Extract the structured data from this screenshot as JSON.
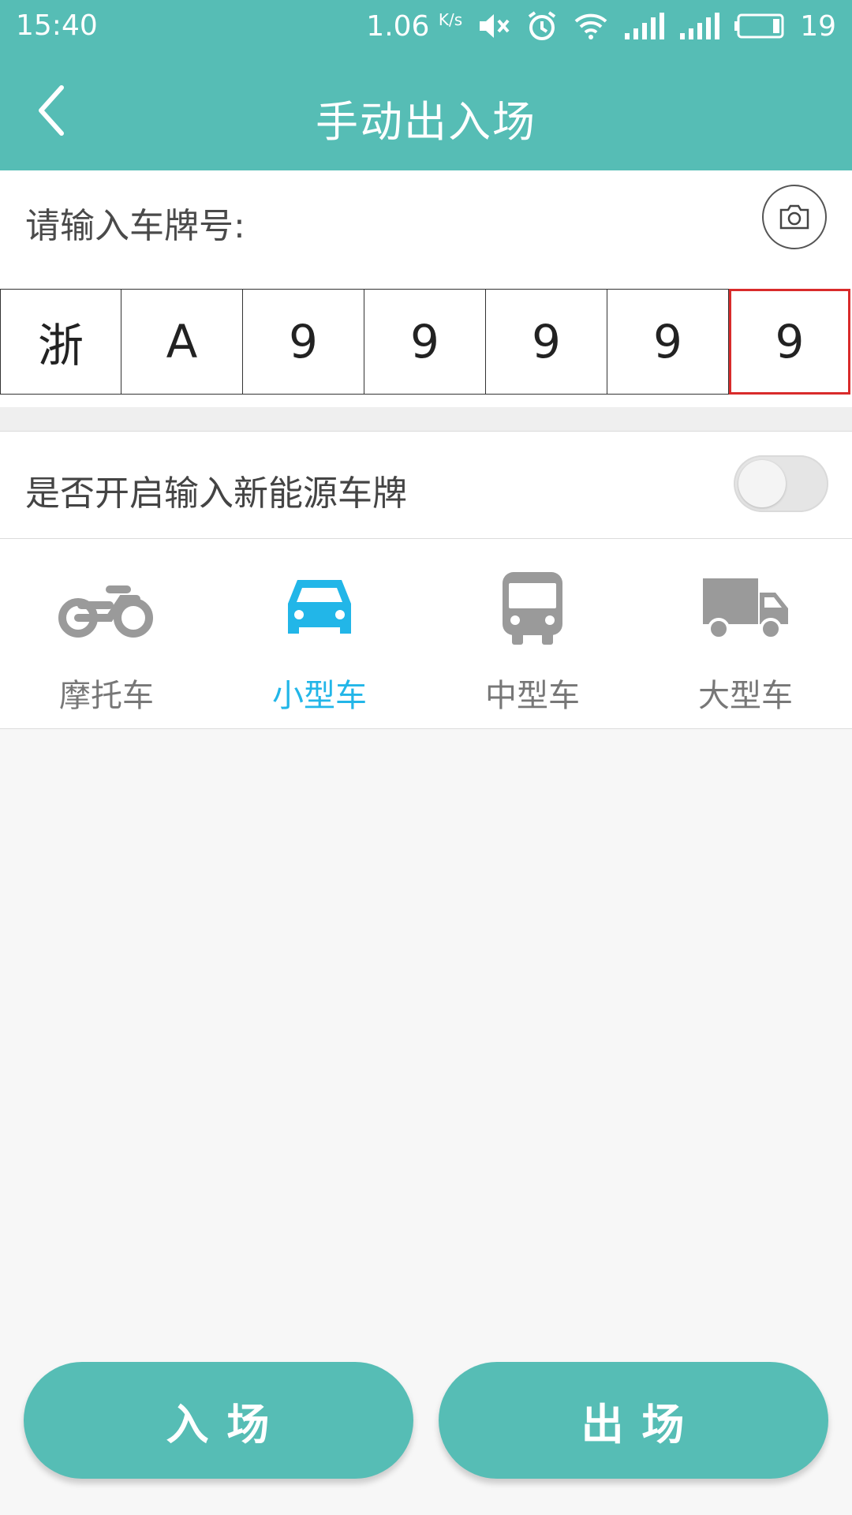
{
  "status_bar": {
    "time": "15:40",
    "speed": "1.06",
    "speed_unit": "K/s",
    "battery": "19"
  },
  "header": {
    "title": "手动出入场"
  },
  "plate": {
    "label": "请输入车牌号:",
    "chars": [
      "浙",
      "A",
      "9",
      "9",
      "9",
      "9",
      "9"
    ],
    "active_index": 6
  },
  "new_energy": {
    "label": "是否开启输入新能源车牌",
    "enabled": false
  },
  "vehicle_types": [
    {
      "label": "摩托车",
      "icon": "motorcycle-icon",
      "selected": false
    },
    {
      "label": "小型车",
      "icon": "car-icon",
      "selected": true
    },
    {
      "label": "中型车",
      "icon": "bus-icon",
      "selected": false
    },
    {
      "label": "大型车",
      "icon": "truck-icon",
      "selected": false
    }
  ],
  "buttons": {
    "enter": "入 场",
    "exit": "出 场"
  },
  "colors": {
    "primary": "#56bdb5",
    "selected": "#22b6e8",
    "active_border": "#d92b2b",
    "icon_gray": "#9a9a9a"
  }
}
